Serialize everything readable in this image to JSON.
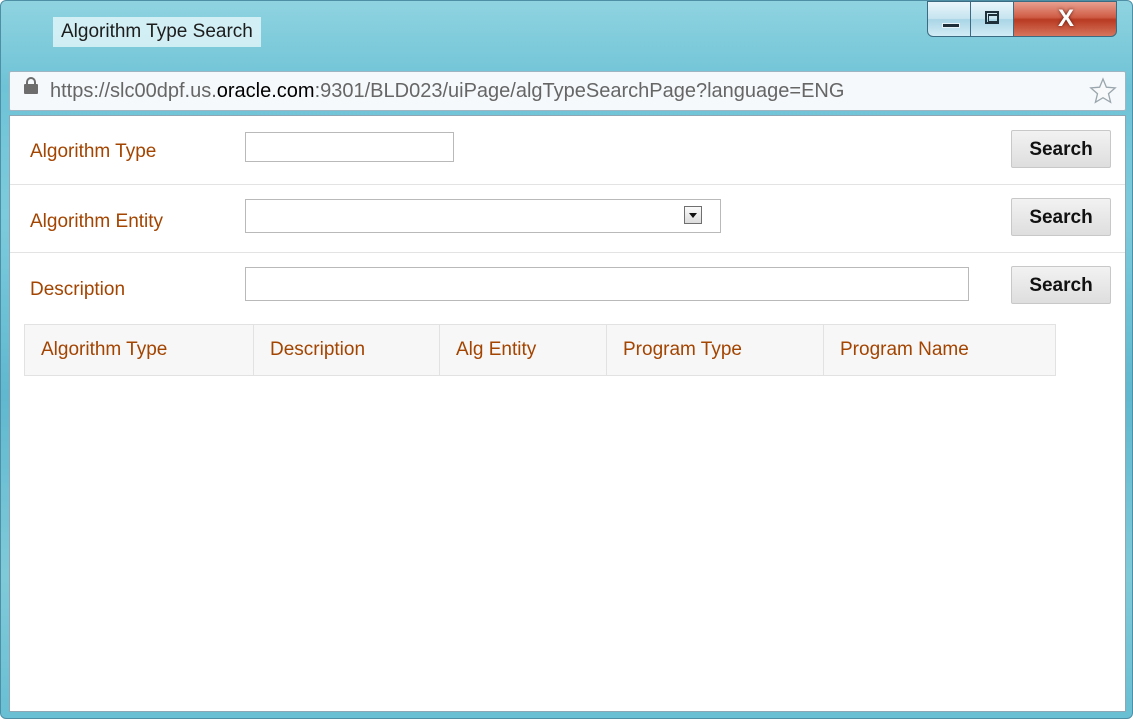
{
  "window": {
    "title": "Algorithm Type Search",
    "close_glyph": "X"
  },
  "address_bar": {
    "url_prefix": "https://slc00dpf.us.",
    "url_domain": "oracle.com",
    "url_suffix": ":9301/BLD023/uiPage/algTypeSearchPage?language=ENG"
  },
  "form": {
    "algorithm_type_label": "Algorithm Type",
    "algorithm_type_value": "",
    "algorithm_entity_label": "Algorithm Entity",
    "algorithm_entity_value": "",
    "description_label": "Description",
    "description_value": "",
    "search_label": "Search"
  },
  "results_table": {
    "columns": [
      "Algorithm Type",
      "Description",
      "Alg Entity",
      "Program Type",
      "Program Name"
    ],
    "rows": []
  },
  "colors": {
    "label": "#a34400",
    "frame": "#6ec3d6"
  }
}
